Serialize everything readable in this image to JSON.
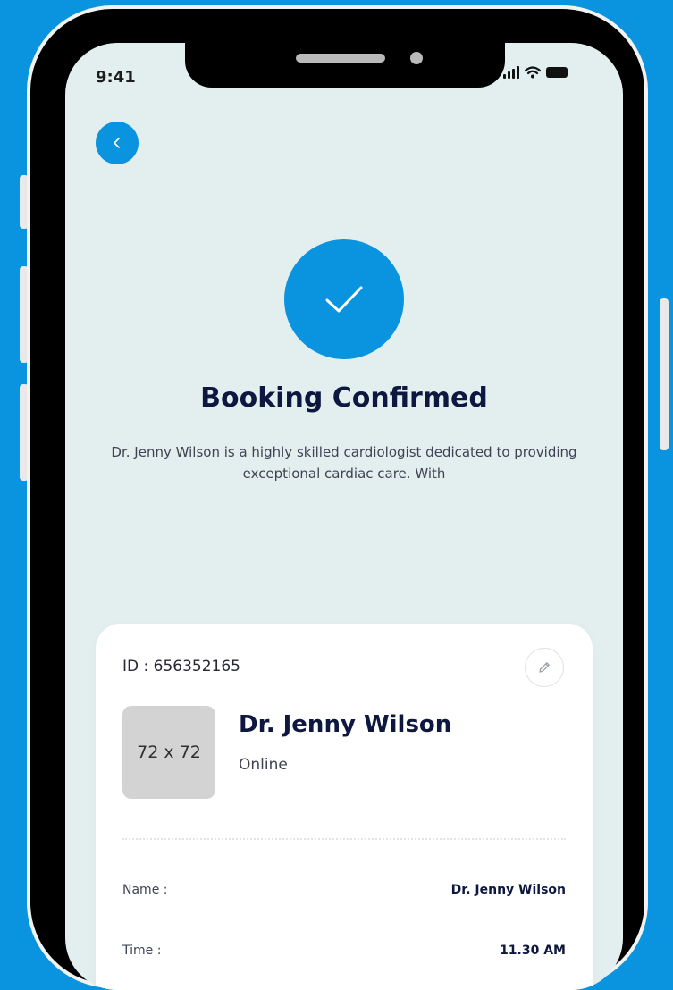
{
  "status_bar": {
    "time": "9:41"
  },
  "icons": {
    "back": "chevron-left-icon",
    "check": "check-icon",
    "edit": "pencil-icon",
    "signal": "signal-icon",
    "wifi": "wifi-icon",
    "battery": "battery-icon"
  },
  "confirmation": {
    "title": "Booking Confirmed",
    "description": "Dr. Jenny Wilson is a highly skilled cardiologist dedicated to providing exceptional cardiac care. With"
  },
  "booking": {
    "id_label": "ID : 656352165",
    "photo_placeholder": "72 x 72",
    "doctor_name": "Dr. Jenny Wilson",
    "mode": "Online",
    "rows": [
      {
        "label": "Name :",
        "value": "Dr. Jenny Wilson"
      },
      {
        "label": "Time :",
        "value": "11.30 AM"
      }
    ]
  },
  "colors": {
    "primary": "#0a94df",
    "screen_background": "#e3efef",
    "heading": "#0e173f",
    "body_text": "#3f4352"
  }
}
